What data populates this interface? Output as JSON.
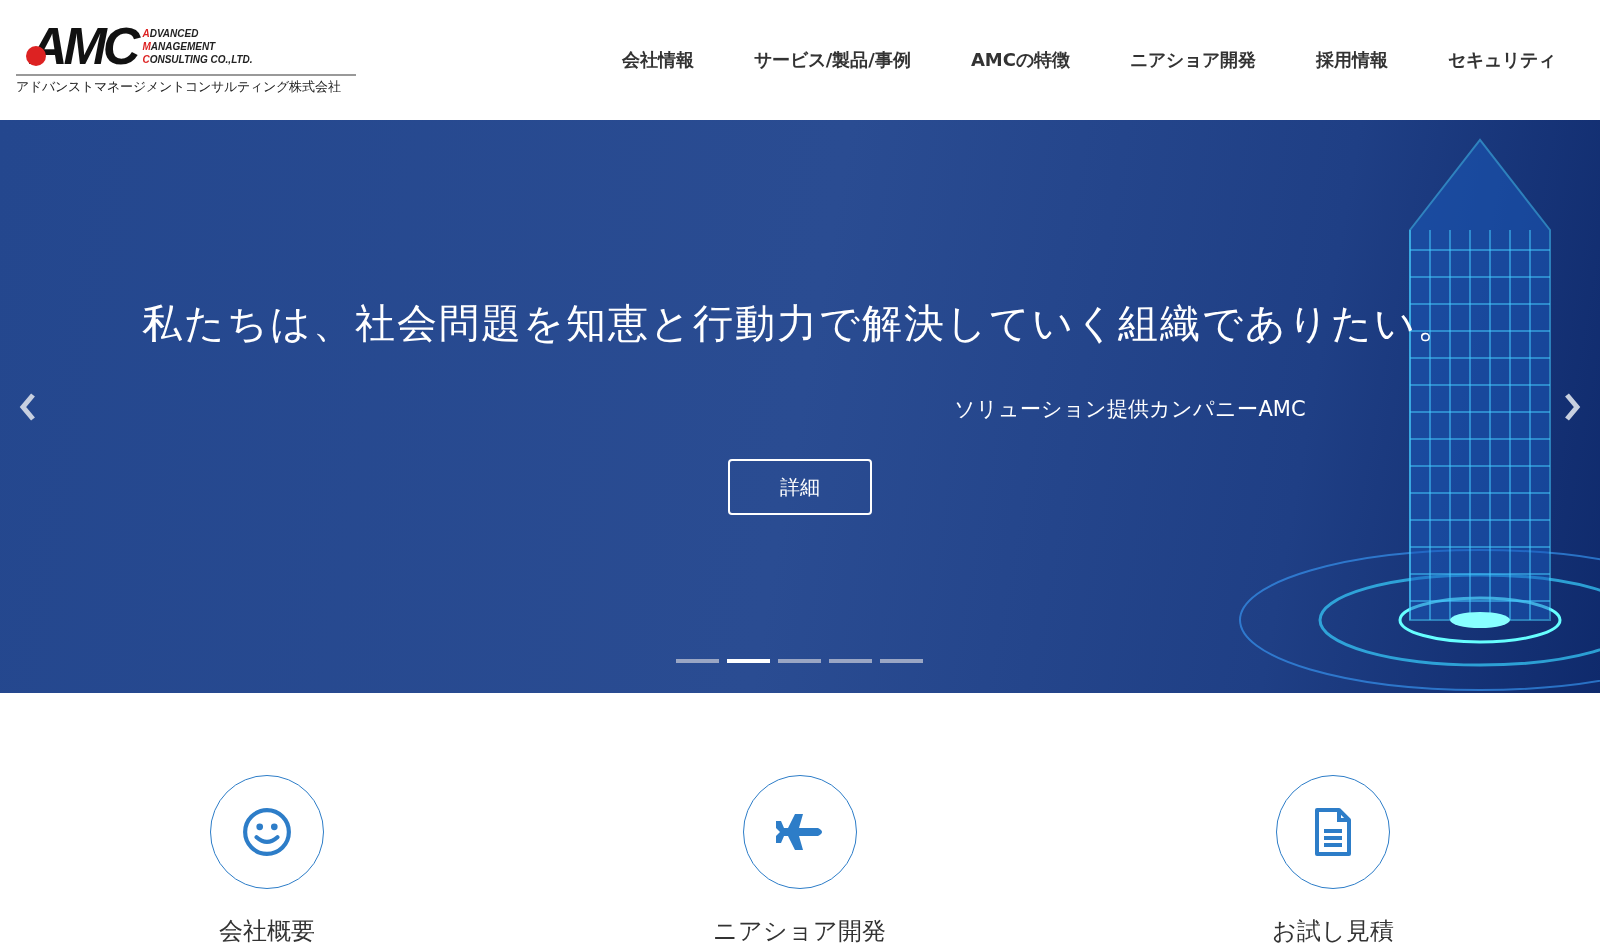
{
  "logo": {
    "mark": "AMC",
    "lines": [
      "ADVANCED",
      "MANAGEMENT",
      "CONSULTING CO.,LTD."
    ],
    "subtitle": "アドバンストマネージメントコンサルティング株式会社"
  },
  "nav": [
    "会社情報",
    "サービス/製品/事例",
    "AMCの特徴",
    "ニアショア開発",
    "採用情報",
    "セキュリティ"
  ],
  "hero": {
    "headline": "私たちは、社会問題を知恵と行動力で解決していく組織でありたい。",
    "tagline": "ソリューション提供カンパニーAMC",
    "button": "詳細",
    "indicators": [
      {
        "selected": false
      },
      {
        "selected": true
      },
      {
        "selected": false
      },
      {
        "selected": false
      },
      {
        "selected": false
      }
    ]
  },
  "features": [
    {
      "kind": "smile",
      "label": "会社概要"
    },
    {
      "kind": "plane",
      "label": "ニアショア開発"
    },
    {
      "kind": "document",
      "label": "お試し見積"
    }
  ]
}
